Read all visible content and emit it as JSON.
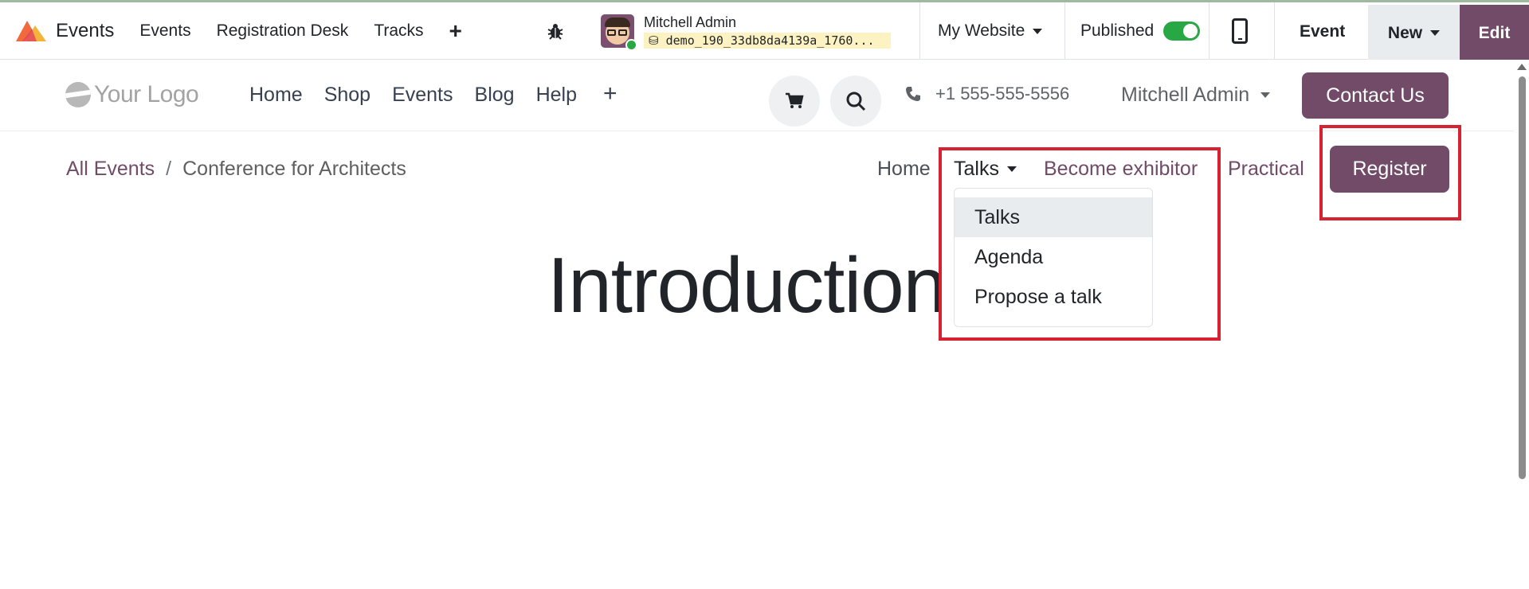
{
  "topbar": {
    "app_name": "Events",
    "menu": [
      "Events",
      "Registration Desk",
      "Tracks"
    ],
    "plus_icon": "plus-icon",
    "bug_icon": "bug-icon",
    "user": {
      "name": "Mitchell Admin",
      "database": "demo_190_33db8da4139a_1760..."
    },
    "website": "My Website",
    "published_label": "Published",
    "published": true,
    "mobile_icon": "mobile-preview-icon",
    "event_label": "Event",
    "new_label": "New",
    "edit_label": "Edit"
  },
  "site": {
    "logo_text": "Your Logo",
    "menu": [
      "Home",
      "Shop",
      "Events",
      "Blog",
      "Help"
    ],
    "phone": "+1 555-555-5556",
    "user": "Mitchell Admin",
    "contact_label": "Contact Us"
  },
  "event": {
    "breadcrumb": {
      "root": "All Events",
      "separator": "/",
      "current": "Conference for Architects"
    },
    "menu": {
      "home": "Home",
      "talks": "Talks",
      "exhibitor": "Become exhibitor",
      "practical": "Practical"
    },
    "register_label": "Register",
    "talks_dropdown": [
      "Talks",
      "Agenda",
      "Propose a talk"
    ],
    "hero_title": "Introduction"
  },
  "colors": {
    "brand": "#714b67",
    "highlight": "#d62231",
    "toggle_on": "#28a745"
  }
}
